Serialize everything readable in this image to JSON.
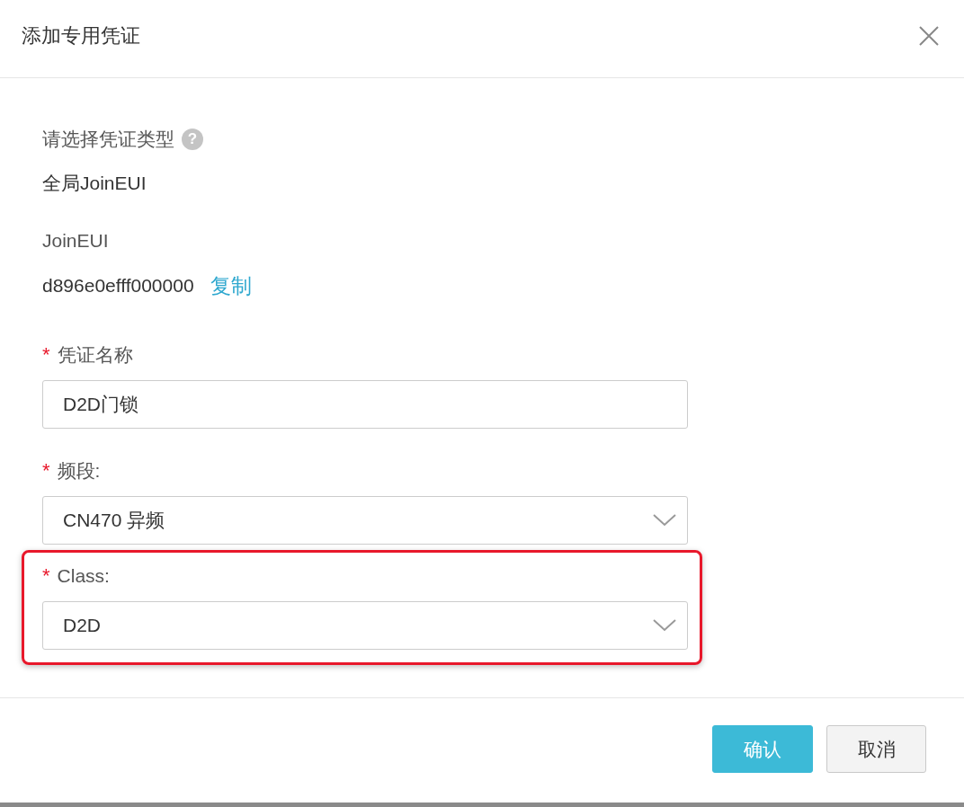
{
  "dialog": {
    "title": "添加专用凭证"
  },
  "credential_type": {
    "label": "请选择凭证类型",
    "help_icon": "?",
    "value": "全局JoinEUI"
  },
  "join_eui": {
    "label": "JoinEUI",
    "value": "d896e0efff000000",
    "copy_link": "复制"
  },
  "fields": [
    {
      "kind": "input",
      "required_mark": "*",
      "label": "凭证名称",
      "value": "D2D门锁",
      "highlighted": false
    },
    {
      "kind": "select",
      "required_mark": "*",
      "label": "频段:",
      "value": "CN470 异频",
      "highlighted": false
    },
    {
      "kind": "select",
      "required_mark": "*",
      "label": "Class:",
      "value": "D2D",
      "highlighted": true
    }
  ],
  "buttons": [
    {
      "label": "确认",
      "primary": true
    },
    {
      "label": "取消",
      "primary": false
    }
  ]
}
